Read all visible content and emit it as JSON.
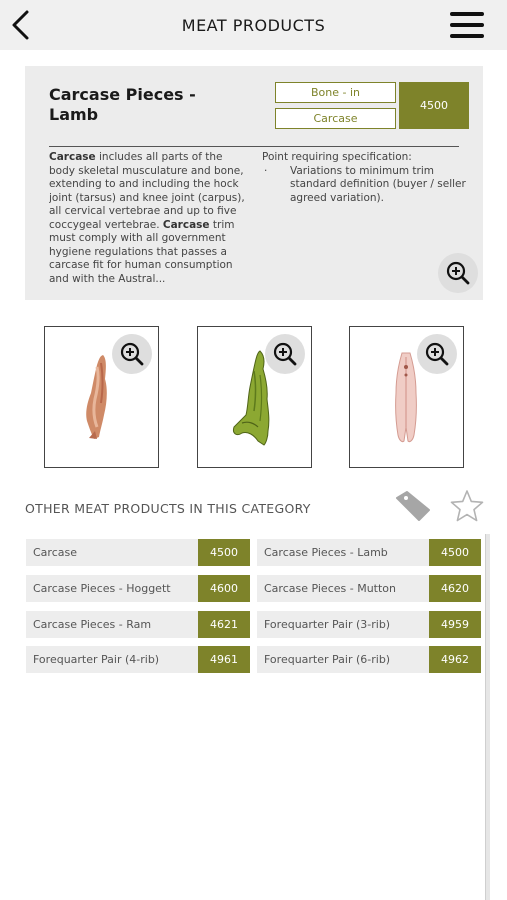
{
  "header": {
    "title": "MEAT PRODUCTS"
  },
  "product": {
    "title": "Carcase Pieces - Lamb",
    "tags": [
      "Bone - in",
      "Carcase"
    ],
    "code": "4500",
    "description_term1": "Carcase",
    "description_text1": " includes all parts of the body skeletal musculature and bone, extending to and including the hock joint (tarsus) and knee joint (carpus), all cervical vertebrae and up to five coccygeal vertebrae. ",
    "description_term2": "Carcase",
    "description_text2": " trim must comply with all government hygiene regulations that passes a carcase fit for human consumption and with the Austral...",
    "spec_heading": "Point requiring specification:",
    "spec_bullet": "·",
    "spec_item": "Variations to minimum trim standard definition (buyer / seller agreed variation).",
    "colors": {
      "accent": "#7e832a",
      "card_bg": "#ececec"
    }
  },
  "icons": {
    "back": "chevron-left-icon",
    "menu": "hamburger-menu-icon",
    "zoom": "zoom-in-icon",
    "tag": "tag-icon",
    "favorite": "star-outline-icon"
  },
  "other": {
    "title": "OTHER MEAT PRODUCTS IN THIS CATEGORY",
    "items": [
      {
        "name": "Carcase",
        "code": "4500"
      },
      {
        "name": "Carcase Pieces - Lamb",
        "code": "4500"
      },
      {
        "name": "Carcase Pieces - Hoggett",
        "code": "4600"
      },
      {
        "name": "Carcase Pieces - Mutton",
        "code": "4620"
      },
      {
        "name": "Carcase Pieces - Ram",
        "code": "4621"
      },
      {
        "name": "Forequarter Pair (3-rib)",
        "code": "4959"
      },
      {
        "name": "Forequarter Pair (4-rib)",
        "code": "4961"
      },
      {
        "name": "Forequarter Pair (6-rib)",
        "code": "4962"
      }
    ]
  }
}
